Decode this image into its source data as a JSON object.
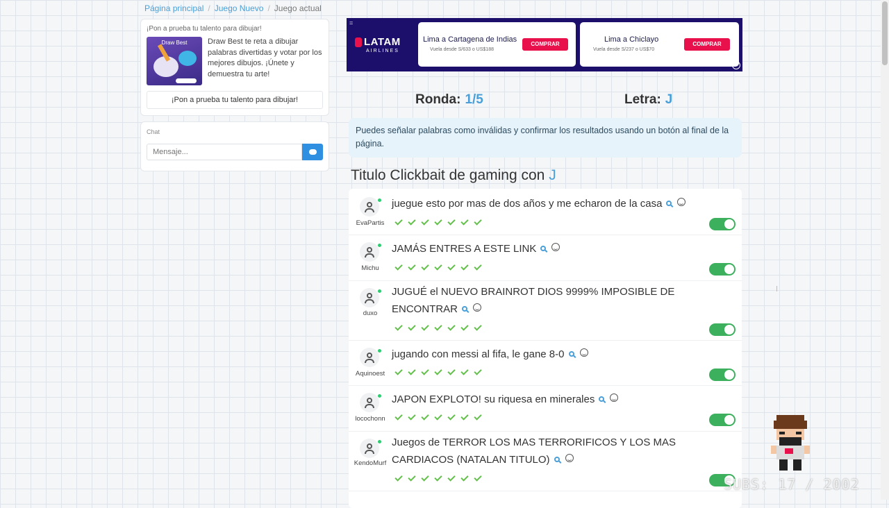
{
  "breadcrumb": {
    "home": "Página principal",
    "new_game": "Juego Nuevo",
    "current": "Juego actual"
  },
  "promo": {
    "heading": "¡Pon a prueba tu talento para dibujar!",
    "thumb_title": "Draw Best",
    "description": "Draw Best te reta a dibujar palabras divertidas y votar por los mejores dibujos. ¡Únete y demuestra tu arte!",
    "button": "¡Pon a prueba tu talento para dibujar!"
  },
  "chat": {
    "title": "Chat",
    "placeholder": "Mensaje..."
  },
  "ad": {
    "menu": "=",
    "brand": "LATAM",
    "brand_sub": "AIRLINES",
    "info": "i",
    "offers": [
      {
        "route": "Lima a Cartagena de Indias",
        "price": "Vuela desde S/633 o US$188",
        "button": "COMPRAR"
      },
      {
        "route": "Lima a Chiclayo",
        "price": "Vuela desde S/237 o US$70",
        "button": "COMPRAR"
      }
    ]
  },
  "game": {
    "round_label": "Ronda:",
    "round_value": "1/5",
    "letter_label": "Letra:",
    "letter_value": "J",
    "notice": "Puedes señalar palabras como inválidas y confirmar los resultados usando un botón al final de la página.",
    "category_label": "Titulo Clickbait de gaming con",
    "category_letter": "J"
  },
  "answers": [
    {
      "user": "EvaPartis",
      "text": "juegue esto por mas de dos años y me echaron de la casa",
      "votes": 7,
      "valid": true
    },
    {
      "user": "Michu",
      "text": "JAMÁS ENTRES A ESTE LINK",
      "votes": 7,
      "valid": true
    },
    {
      "user": "duxo",
      "text": "JUGUÉ el NUEVO BRAINROT DIOS 9999% IMPOSIBLE DE ENCONTRAR",
      "votes": 7,
      "valid": true
    },
    {
      "user": "Aquinoest",
      "text": "jugando con messi al fifa, le gane 8-0",
      "votes": 7,
      "valid": true
    },
    {
      "user": "locochonn",
      "text": "JAPON EXPLOTO! su riquesa en minerales",
      "votes": 7,
      "valid": true
    },
    {
      "user": "KendoMurf",
      "text": "Juegos de TERROR LOS MAS TERRORIFICOS Y LOS MAS CARDIACOS (NATALAN TITULO)",
      "votes": 7,
      "valid": true
    }
  ],
  "overlay": {
    "watermark": "SUBS: 17 / 2002"
  },
  "colors": {
    "accent": "#4a9fd8",
    "toggle_on": "#3cb05c",
    "vote_check": "#63c04b",
    "ad_bg": "#1b0f6b",
    "ad_button": "#e8114b"
  }
}
